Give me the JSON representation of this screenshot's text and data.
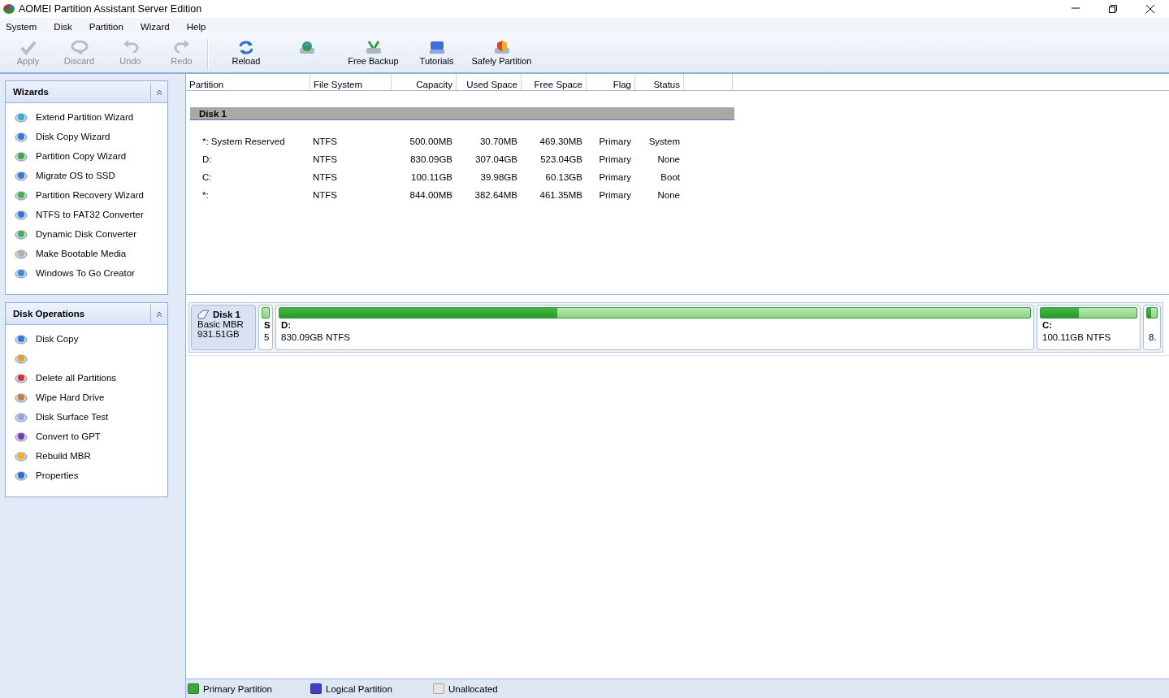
{
  "window": {
    "title": "AOMEI Partition Assistant Server Edition"
  },
  "menu": [
    "System",
    "Disk",
    "Partition",
    "Wizard",
    "Help"
  ],
  "toolbar": [
    {
      "label": "Apply",
      "disabled": true
    },
    {
      "label": "Discard",
      "disabled": true
    },
    {
      "label": "Undo",
      "disabled": true
    },
    {
      "label": "Redo",
      "disabled": true
    },
    {
      "label": "Reload",
      "disabled": false
    },
    {
      "disabled": false
    },
    {
      "label": "Free Backup",
      "disabled": false
    },
    {
      "label": "Tutorials",
      "disabled": false
    },
    {
      "label": "Safely Partition",
      "disabled": false
    }
  ],
  "panels": [
    {
      "title": "Wizards",
      "expanded": true,
      "items": [
        "Extend Partition Wizard",
        "Disk Copy Wizard",
        "Partition Copy Wizard",
        "Migrate OS to SSD",
        "Partition Recovery Wizard",
        "NTFS to FAT32 Converter",
        "Dynamic Disk Converter",
        "Make Bootable Media",
        "Windows To Go Creator"
      ]
    },
    {
      "title": "Disk Operations",
      "expanded": true,
      "items": [
        "Disk Copy",
        "Delete all Partitions",
        "Wipe Hard Drive",
        "Disk Surface Test",
        "Convert to GPT",
        "Rebuild MBR",
        "Properties"
      ]
    }
  ],
  "table": {
    "columns": [
      "Partition",
      "File System",
      "Capacity",
      "Used Space",
      "Free Space",
      "Flag",
      "Status"
    ],
    "group": "Disk 1",
    "rows": [
      [
        "*: System Reserved",
        "NTFS",
        "500.00MB",
        "30.70MB",
        "469.30MB",
        "Primary",
        "System"
      ],
      [
        "D:",
        "NTFS",
        "830.09GB",
        "307.04GB",
        "523.04GB",
        "Primary",
        "None"
      ],
      [
        "C:",
        "NTFS",
        "100.11GB",
        "39.98GB",
        "60.13GB",
        "Primary",
        "Boot"
      ],
      [
        "*:",
        "NTFS",
        "844.00MB",
        "382.64MB",
        "461.35MB",
        "Primary",
        "None"
      ]
    ]
  },
  "disk_map": {
    "name": "Disk 1",
    "type": "Basic MBR",
    "size": "931.51GB",
    "partitions": [
      {
        "name": "S",
        "info": "5"
      },
      {
        "name": "D:",
        "info": "830.09GB NTFS",
        "level": 0.37
      },
      {
        "name": "C:",
        "info": "100.11GB NTFS",
        "level": 0.4
      },
      {
        "info": "8.",
        "level": 0.45
      }
    ]
  },
  "legend": [
    {
      "label": "Primary Partition",
      "color": "#3aa83a"
    },
    {
      "label": "Logical Partition",
      "color": "#4040c8"
    },
    {
      "label": "Unallocated",
      "color": "#e8e4dc"
    }
  ]
}
